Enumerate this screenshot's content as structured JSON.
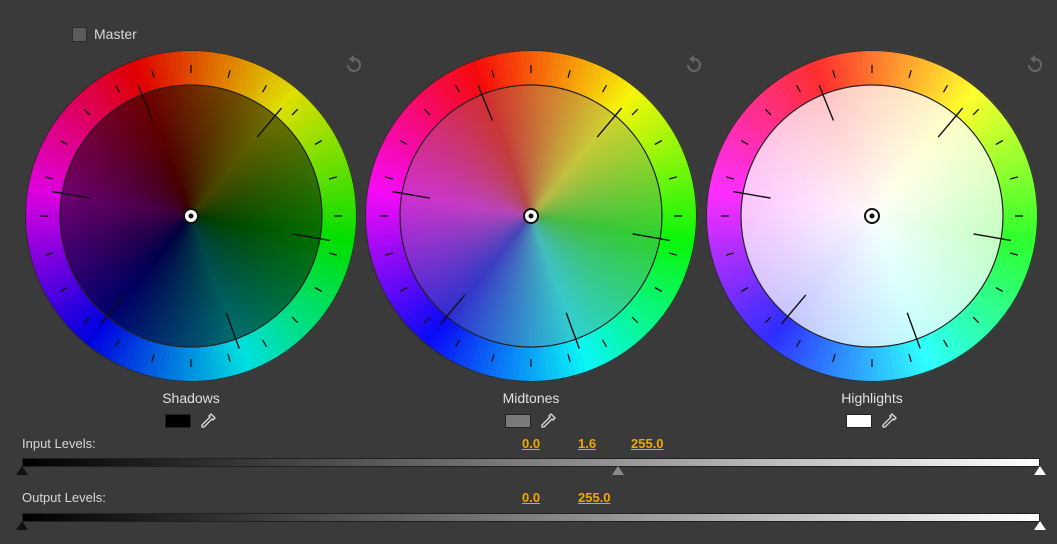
{
  "master": {
    "label": "Master",
    "checked": false
  },
  "wheels": [
    {
      "label": "Shadows",
      "swatch": "#000000",
      "tint": "#000000",
      "tintOpacity": 0.5
    },
    {
      "label": "Midtones",
      "swatch": "#7a7a7a",
      "tint": "#808080",
      "tintOpacity": 0.3
    },
    {
      "label": "Highlights",
      "swatch": "#ffffff",
      "tint": "#ffffff",
      "tintOpacity": 0.72
    }
  ],
  "input_levels": {
    "label": "Input Levels:",
    "black": "0.0",
    "gamma": "1.6",
    "white": "255.0"
  },
  "output_levels": {
    "label": "Output Levels:",
    "black": "0.0",
    "white": "255.0"
  },
  "colors": {
    "accent": "#f0a800",
    "background": "#3a3a3a"
  }
}
